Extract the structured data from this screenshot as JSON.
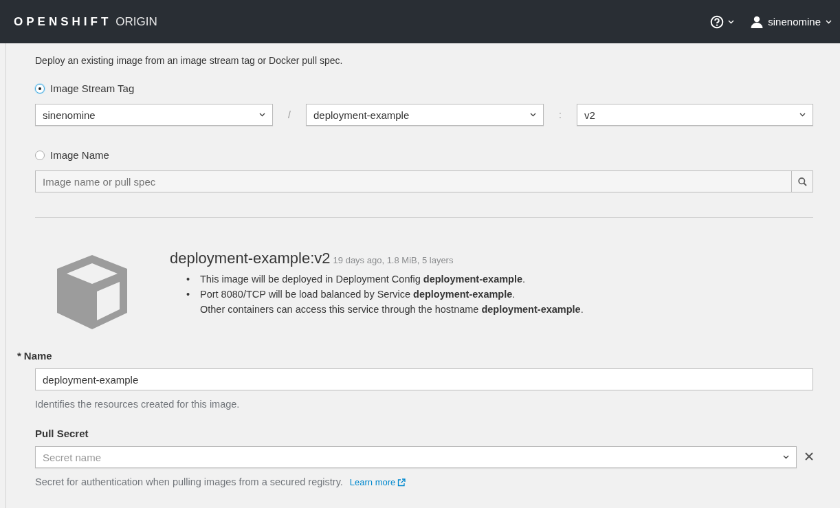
{
  "header": {
    "brand": "OPENSHIFT",
    "product": "ORIGIN",
    "user": "sinenomine"
  },
  "intro": "Deploy an existing image from an image stream tag or Docker pull spec.",
  "source_options": [
    {
      "label": "Image Stream Tag",
      "selected": true
    },
    {
      "label": "Image Name",
      "selected": false
    }
  ],
  "image_stream_tag": {
    "namespace": "sinenomine",
    "separator_1": "/",
    "image_stream": "deployment-example",
    "separator_2": ":",
    "tag": "v2"
  },
  "image_name": {
    "placeholder": "Image name or pull spec"
  },
  "image_info": {
    "title": "deployment-example:v2",
    "meta": "19 days ago, 1.8 MiB, 5 layers",
    "bullets": [
      {
        "marker": "•",
        "text": "This image will be deployed in Deployment Config **deployment-example**."
      },
      {
        "marker": "•",
        "text": "Port 8080/TCP will be load balanced by Service **deployment-example**.",
        "note": "Other containers can access this service through the hostname **deployment-example**."
      }
    ]
  },
  "name_field": {
    "required_mark": "*",
    "label": "Name",
    "value": "deployment-example",
    "help": "Identifies the resources created for this image."
  },
  "pull_secret": {
    "label": "Pull Secret",
    "placeholder": "Secret name",
    "help": "Secret for authentication when pulling images from a secured registry.",
    "link": "Learn more"
  }
}
